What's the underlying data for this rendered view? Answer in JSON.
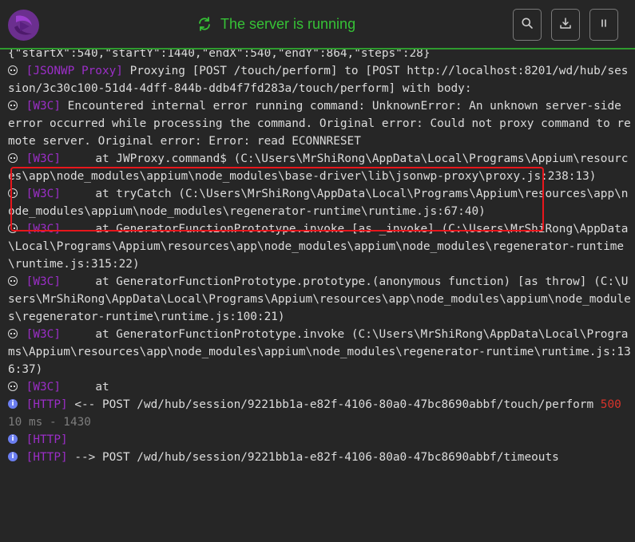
{
  "header": {
    "status_text": "The server is running",
    "buttons": [
      {
        "name": "search-button",
        "icon": "search-icon"
      },
      {
        "name": "download-logs-button",
        "icon": "download-icon"
      },
      {
        "name": "pause-button",
        "icon": "pause-icon"
      }
    ]
  },
  "colors": {
    "background": "#262626",
    "status_green": "#36c236",
    "tag_purple": "#9b2ec7",
    "error_red": "#d9342b",
    "highlight_red": "#e8161c",
    "info_blue": "#6b7ef0"
  },
  "log": {
    "partial_line": "{\"startX\":540,\"startY\":1440,\"endX\":540,\"endY\":864,\"steps\":28}",
    "entries": [
      {
        "icon": "debug-icon",
        "tag": "[JSONWP Proxy]",
        "text": " Proxying [POST /touch/perform] to [POST http://localhost:8201/wd/hub/session/3c30c100-51d4-4dff-844b-ddb4f7fd283a/touch/perform] with body:"
      },
      {
        "icon": "debug-icon",
        "tag": "[W3C]",
        "text": " Encountered internal error running command: UnknownError: An unknown server-side error occurred while processing the command. Original error: Could not proxy command to remote server. Original error: Error: read ECONNRESET"
      },
      {
        "icon": "debug-icon",
        "tag": "[W3C]",
        "text": "     at JWProxy.command$ (C:\\Users\\MrShiRong\\AppData\\Local\\Programs\\Appium\\resources\\app\\node_modules\\appium\\node_modules\\base-driver\\lib\\jsonwp-proxy\\proxy.js:238:13)"
      },
      {
        "icon": "debug-icon",
        "tag": "[W3C]",
        "text": "     at tryCatch (C:\\Users\\MrShiRong\\AppData\\Local\\Programs\\Appium\\resources\\app\\node_modules\\appium\\node_modules\\regenerator-runtime\\runtime.js:67:40)"
      },
      {
        "icon": "debug-icon",
        "tag": "[W3C]",
        "text": "     at GeneratorFunctionPrototype.invoke [as _invoke] (C:\\Users\\MrShiRong\\AppData\\Local\\Programs\\Appium\\resources\\app\\node_modules\\appium\\node_modules\\regenerator-runtime\\runtime.js:315:22)"
      },
      {
        "icon": "debug-icon",
        "tag": "[W3C]",
        "text": "     at GeneratorFunctionPrototype.prototype.(anonymous function) [as throw] (C:\\Users\\MrShiRong\\AppData\\Local\\Programs\\Appium\\resources\\app\\node_modules\\appium\\node_modules\\regenerator-runtime\\runtime.js:100:21)"
      },
      {
        "icon": "debug-icon",
        "tag": "[W3C]",
        "text": "     at GeneratorFunctionPrototype.invoke (C:\\Users\\MrShiRong\\AppData\\Local\\Programs\\Appium\\resources\\app\\node_modules\\appium\\node_modules\\regenerator-runtime\\runtime.js:136:37)"
      },
      {
        "icon": "debug-icon",
        "tag": "[W3C]",
        "text": "     at"
      },
      {
        "icon": "info-icon",
        "tag": "[HTTP]",
        "text": " <-- POST /wd/hub/session/9221bb1a-e82f-4106-80a0-47bc8690abbf/touch/perform ",
        "status_code": "500",
        "meta": " 10 ms - 1430"
      },
      {
        "icon": "info-icon",
        "tag": "[HTTP]",
        "text": ""
      },
      {
        "icon": "info-icon",
        "tag": "[HTTP]",
        "text": " --> POST /wd/hub/session/9221bb1a-e82f-4106-80a0-47bc8690abbf/timeouts"
      }
    ]
  }
}
